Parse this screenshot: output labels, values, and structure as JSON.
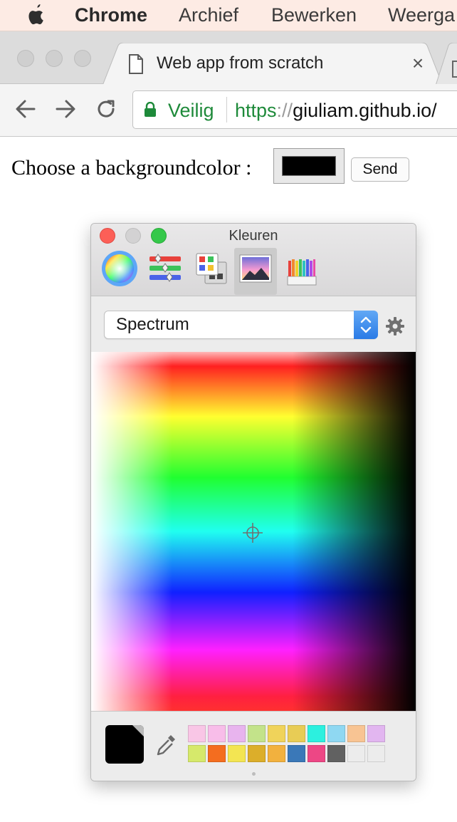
{
  "menubar": {
    "app": "Chrome",
    "items": [
      "Archief",
      "Bewerken",
      "Weerga"
    ]
  },
  "tab": {
    "title": "Web app from scratch",
    "close": "×"
  },
  "omnibox": {
    "secure_label": "Veilig",
    "scheme": "https",
    "slashes": "://",
    "host": "giuliam.github.io/"
  },
  "page": {
    "prompt": "Choose a backgroundcolor :",
    "selected_color": "#000000",
    "send_label": "Send"
  },
  "color_panel": {
    "title": "Kleuren",
    "modes": [
      "color-wheel",
      "sliders",
      "palettes",
      "image",
      "pencils"
    ],
    "active_mode": "image",
    "picker": "Spectrum",
    "current_color": "#000000",
    "swatches": [
      [
        "#f9c6e6",
        "#f8bde9",
        "#e8b4ee",
        "#c3e38a",
        "#f0d35a",
        "#e8cc55",
        "#2cf0df",
        "#8fd8f2",
        "#f8c493",
        "#e2b6f0"
      ],
      [
        "#d6e96b",
        "#f46d1f",
        "#f3e552",
        "#dcae2a",
        "#f2b13e",
        "#3a78b8",
        "#ed4785",
        "#616161",
        "#ececec",
        "#ececec"
      ]
    ]
  },
  "colors": {
    "secure_green": "#1e8a3a",
    "stepper_blue": "#2a7be6"
  }
}
